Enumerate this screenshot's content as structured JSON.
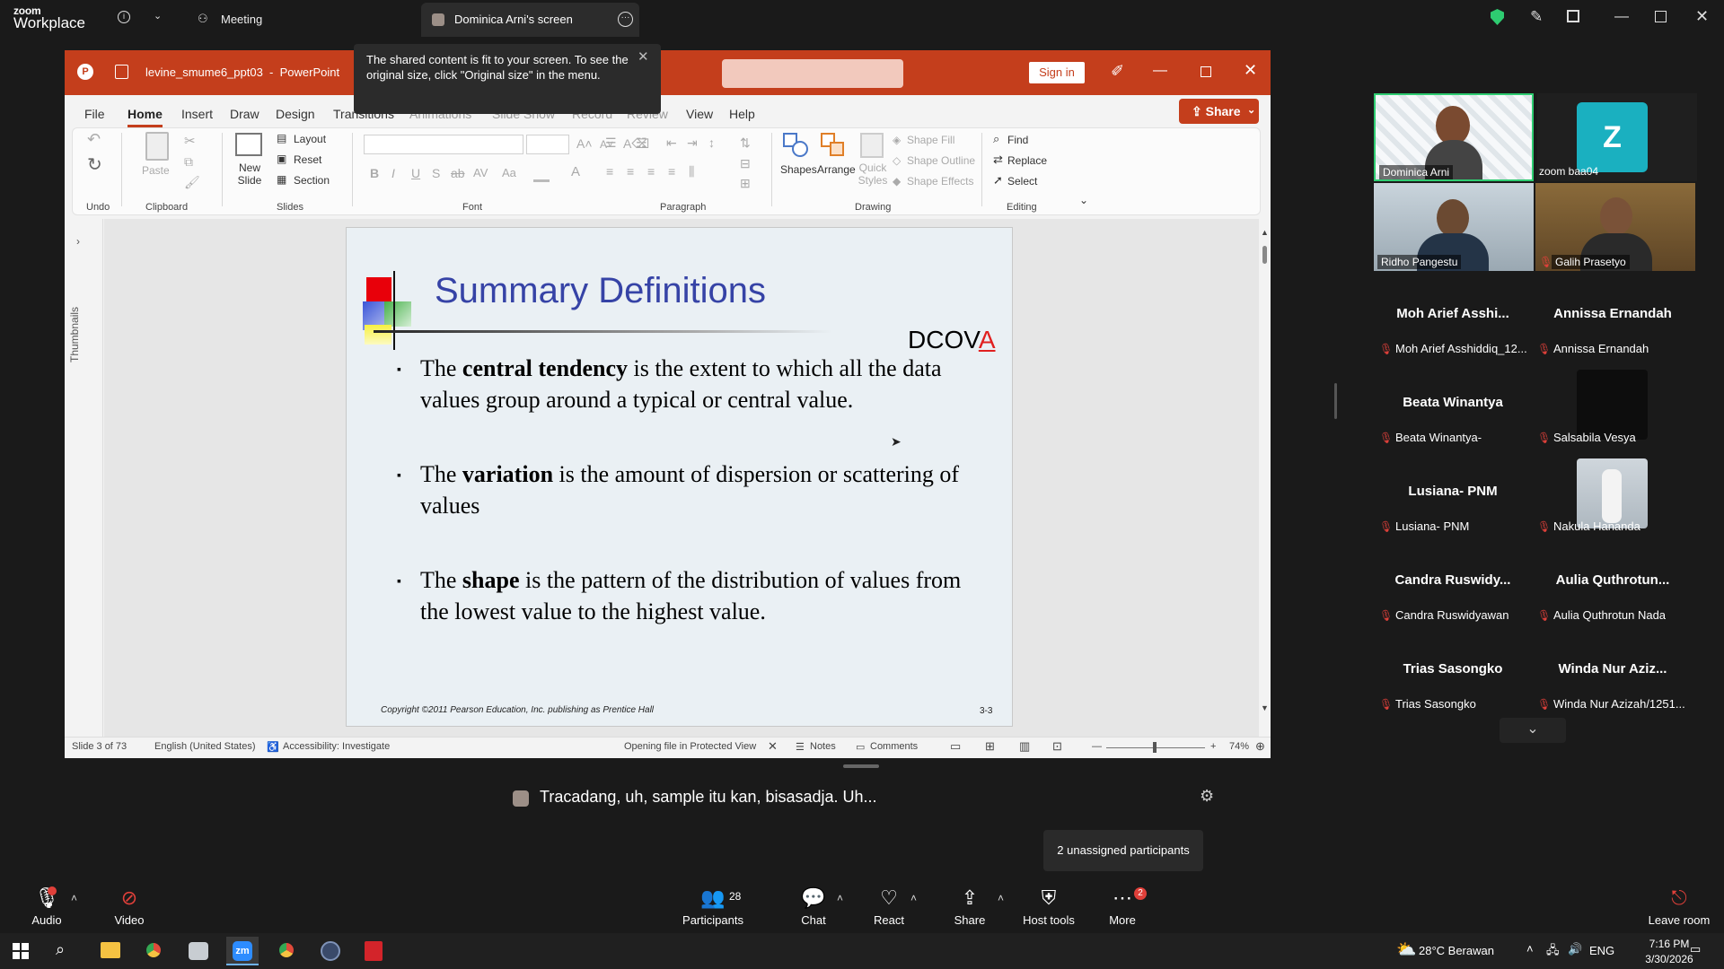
{
  "topbar": {
    "logo_top": "zoom",
    "logo_bottom": "Workplace",
    "meeting_label": "Meeting",
    "share_tab_label": "Dominica Arni's screen"
  },
  "ppt": {
    "filename": "levine_smume6_ppt03",
    "app_name": "PowerPoint",
    "sign_in": "Sign in",
    "share": "Share",
    "menu": [
      "File",
      "Home",
      "Insert",
      "Draw",
      "Design",
      "Transitions",
      "Animations",
      "Slide Show",
      "Record",
      "Review",
      "View",
      "Help"
    ],
    "ribbon": {
      "undo_group": "Undo",
      "clipboard_group": "Clipboard",
      "paste": "Paste",
      "new_slide": "New Slide",
      "layout": "Layout",
      "reset": "Reset",
      "section": "Section",
      "slides_group": "Slides",
      "font_group": "Font",
      "paragraph_group": "Paragraph",
      "shapes": "Shapes",
      "arrange": "Arrange",
      "quick_styles": "Quick Styles",
      "shape_fill": "Shape Fill",
      "shape_outline": "Shape Outline",
      "shape_effects": "Shape Effects",
      "drawing_group": "Drawing",
      "find": "Find",
      "replace": "Replace",
      "select": "Select",
      "editing_group": "Editing"
    },
    "thumbnails_label": "Thumbnails",
    "slide": {
      "title": "Summary Definitions",
      "dcova_prefix": "DCOV",
      "dcova_highlight": "A",
      "bullets": [
        {
          "pre": "The ",
          "bold": "central tendency",
          "post": " is the extent to which all the data values group around a typical or central value."
        },
        {
          "pre": "The ",
          "bold": "variation",
          "post": " is the amount of dispersion or scattering of values"
        },
        {
          "pre": "The ",
          "bold": "shape",
          "post": " is the pattern of the distribution of values from the lowest value to the highest value."
        }
      ],
      "copyright": "Copyright ©2011 Pearson Education, Inc. publishing as Prentice Hall",
      "page": "3-3"
    },
    "status": {
      "slide_of": "Slide 3 of 73",
      "language": "English (United States)",
      "accessibility": "Accessibility: Investigate",
      "protected": "Opening file in Protected View",
      "notes": "Notes",
      "comments": "Comments",
      "zoom": "74%"
    }
  },
  "toast": {
    "text": "The shared content is fit to your screen. To see the original size, click \"Original size\" in the menu."
  },
  "participants": {
    "video_tiles": [
      {
        "name": "Dominica Arni"
      },
      {
        "name": "zoom baa04",
        "initial": "Z"
      },
      {
        "name": "Ridho Pangestu"
      },
      {
        "name": "Galih Prasetyo"
      }
    ],
    "list": [
      {
        "display": "Moh Arief Asshi...",
        "label": "Moh Arief Asshiddiq_12..."
      },
      {
        "display": "Annissa Ernandah",
        "label": "Annissa Ernandah"
      },
      {
        "display": "Beata Winantya",
        "label": "Beata Winantya-"
      },
      {
        "display": "",
        "label": "Salsabila Vesya"
      },
      {
        "display": "Lusiana- PNM",
        "label": "Lusiana- PNM"
      },
      {
        "display": "",
        "label": "Nakula Hananda"
      },
      {
        "display": "Candra  Ruswidy...",
        "label": "Candra Ruswidyawan"
      },
      {
        "display": "Aulia  Quthrotun...",
        "label": "Aulia Quthrotun Nada"
      },
      {
        "display": "Trias Sasongko",
        "label": "Trias Sasongko"
      },
      {
        "display": "Winda Nur Aziz...",
        "label": "Winda Nur Azizah/1251..."
      }
    ]
  },
  "caption": "Tracadang, uh, sample itu kan, bisasadja. Uh...",
  "unassigned": "2 unassigned participants",
  "toolbar": {
    "audio": "Audio",
    "video": "Video",
    "participants": "Participants",
    "participants_count": "28",
    "chat": "Chat",
    "react": "React",
    "share": "Share",
    "host_tools": "Host tools",
    "more": "More",
    "more_badge": "2",
    "leave": "Leave room"
  },
  "taskbar": {
    "weather": "28°C  Berawan",
    "lang": "ENG",
    "time": "7:16 PM",
    "date": "3/30/2026"
  },
  "colors": {
    "ppt_accent": "#c43e1c",
    "slide_title": "#3643a6",
    "zoom_red": "#e0403a",
    "active_speaker": "#2ecc71"
  }
}
